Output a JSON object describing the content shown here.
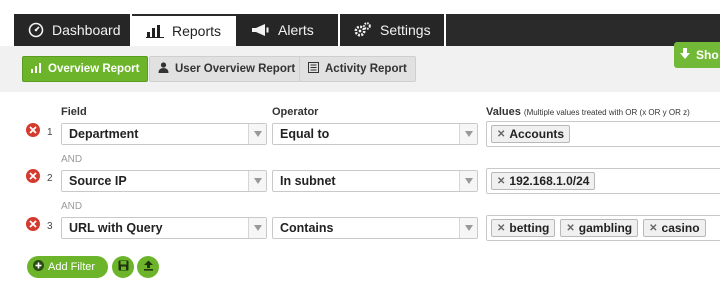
{
  "nav": {
    "tabs": [
      {
        "label": "Dashboard",
        "icon": "dashboard-gauge-icon"
      },
      {
        "label": "Reports",
        "icon": "bar-chart-icon"
      },
      {
        "label": "Alerts",
        "icon": "megaphone-icon"
      },
      {
        "label": "Settings",
        "icon": "gears-icon"
      }
    ],
    "active_tab": "Reports"
  },
  "subnav": {
    "buttons": [
      {
        "label": "Overview Report",
        "icon": "bar-chart-icon"
      },
      {
        "label": "User Overview Report",
        "icon": "user-icon"
      },
      {
        "label": "Activity Report",
        "icon": "list-icon"
      }
    ],
    "active_button": "Overview Report",
    "show_button": {
      "label": "Sho",
      "icon": "arrow-down-icon"
    }
  },
  "filters": {
    "headers": {
      "field": "Field",
      "operator": "Operator",
      "values": "Values",
      "values_note": "(Multiple values treated with OR (x OR y OR z)"
    },
    "joiner": "AND",
    "rows": [
      {
        "num": "1",
        "field": "Department",
        "operator": "Equal to",
        "values": [
          "Accounts"
        ]
      },
      {
        "num": "2",
        "field": "Source IP",
        "operator": "In subnet",
        "values": [
          "192.168.1.0/24"
        ]
      },
      {
        "num": "3",
        "field": "URL with Query",
        "operator": "Contains",
        "values": [
          "betting",
          "gambling",
          "casino"
        ]
      }
    ],
    "add_filter_label": "Add Filter"
  },
  "colors": {
    "accent_green": "#6cb52a",
    "nav_dark": "#2a2a2a",
    "delete_red": "#d53a2e"
  }
}
